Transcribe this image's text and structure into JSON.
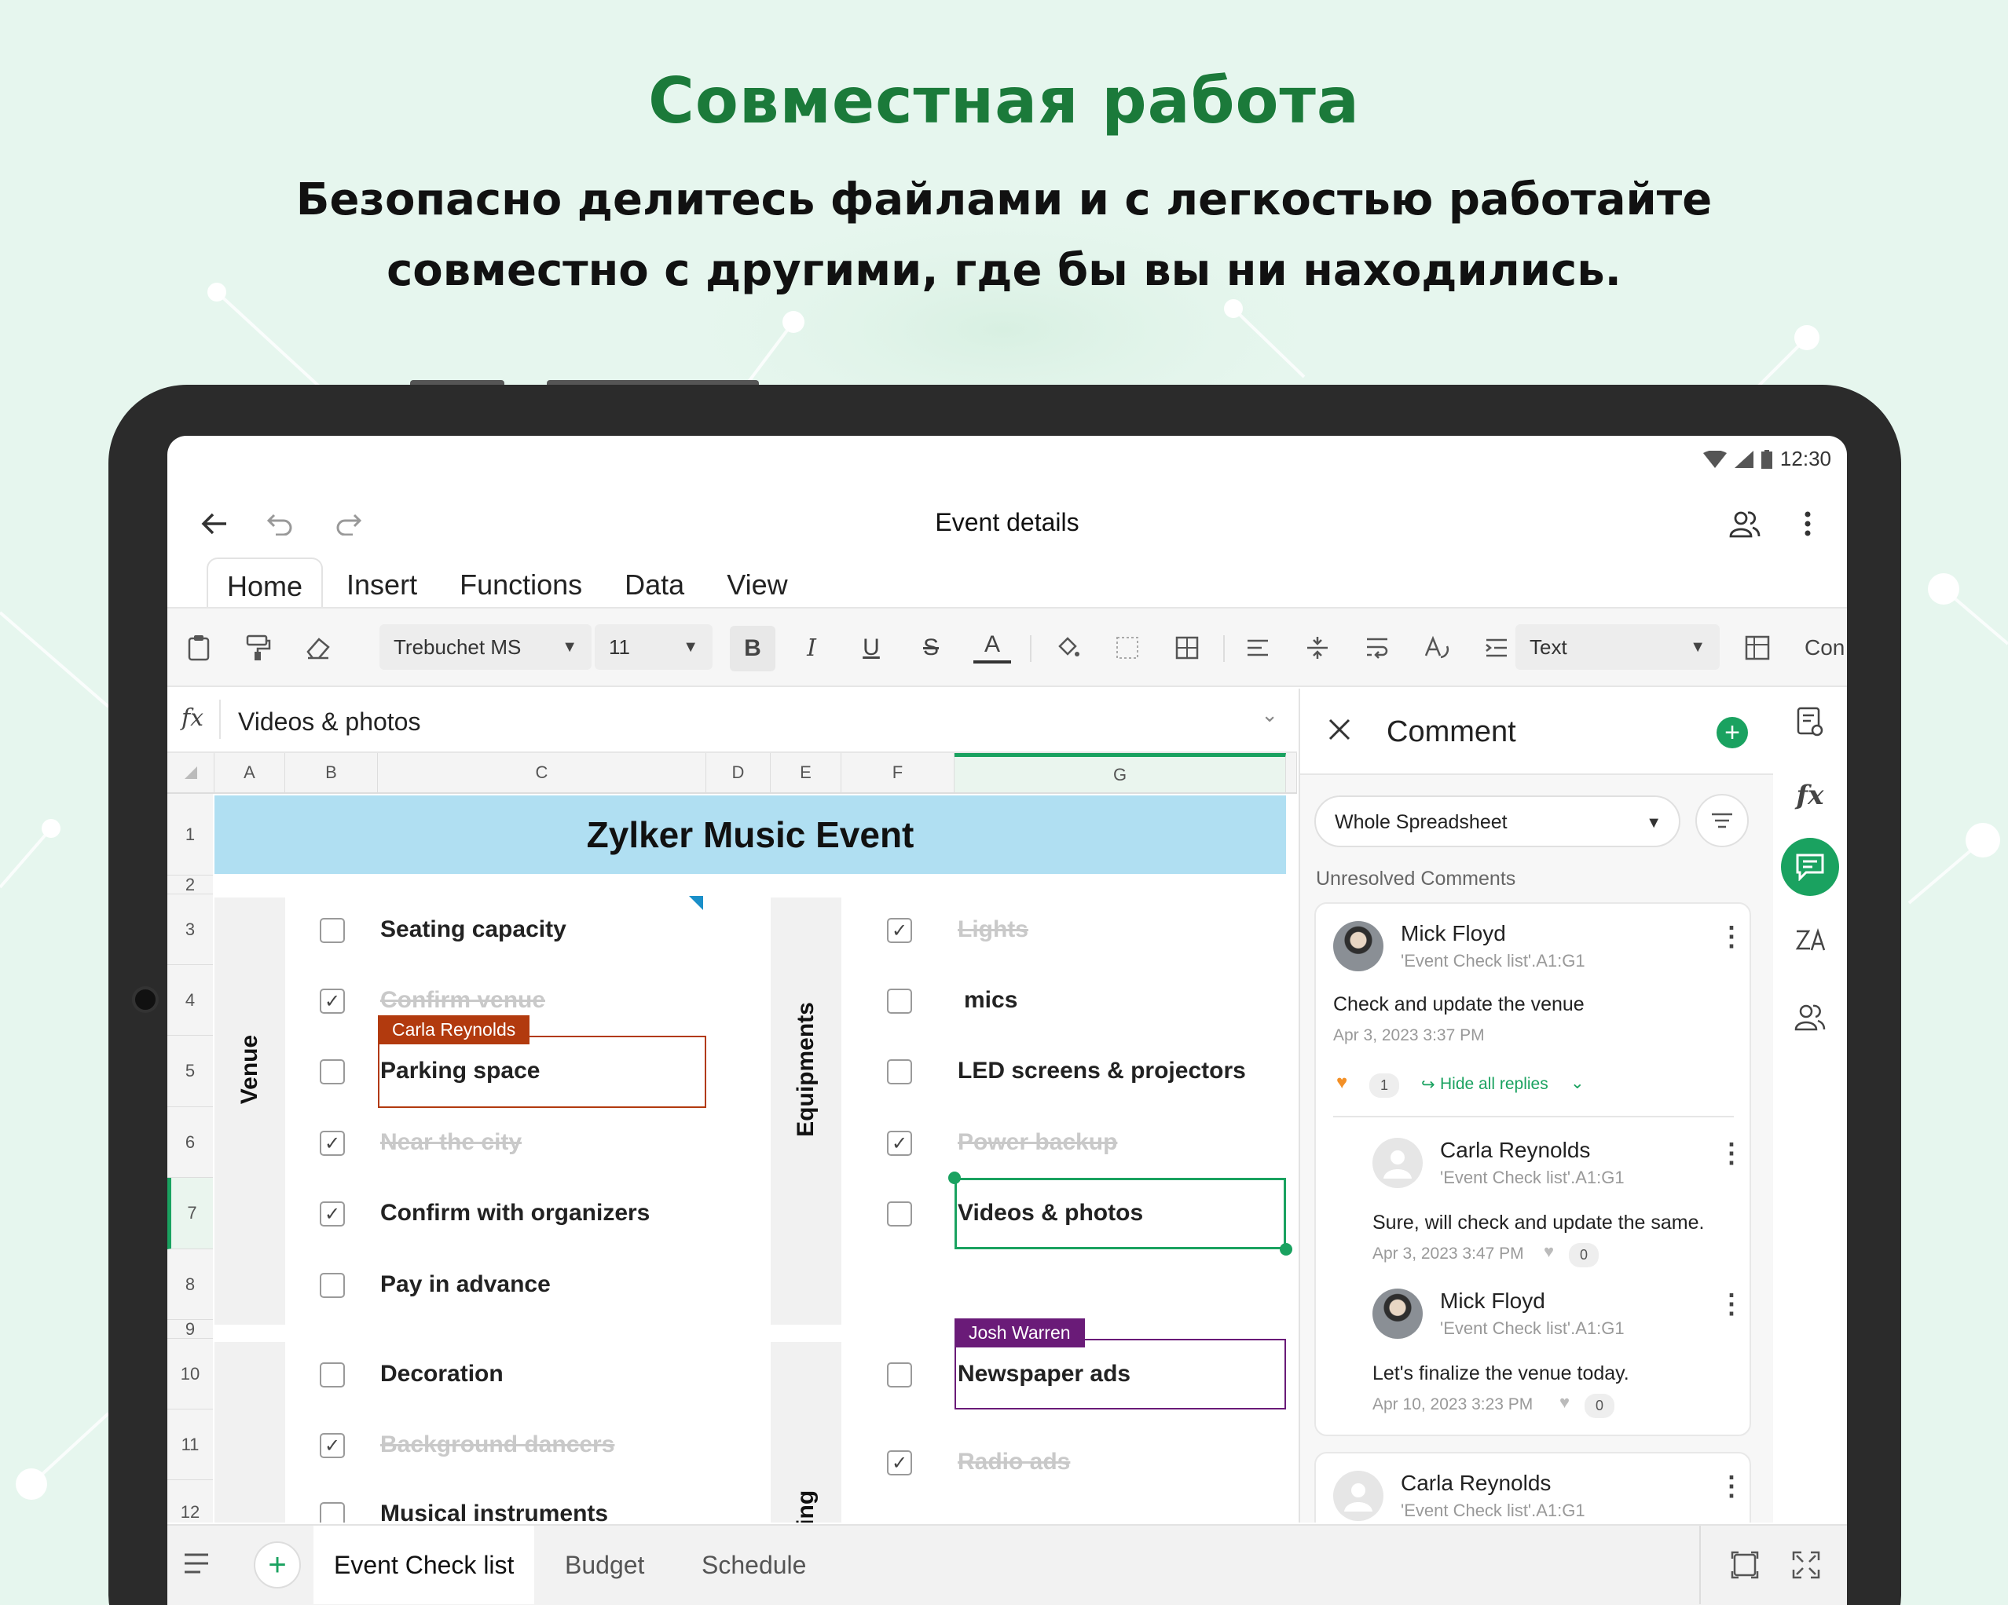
{
  "promo": {
    "title": "Совместная работа",
    "subtitle_line1": "Безопасно делитесь файлами и с легкостью работайте",
    "subtitle_line2": "совместно с другими, где бы вы ни находились."
  },
  "status": {
    "time": "12:30"
  },
  "app": {
    "title": "Event details",
    "tabs": [
      "Home",
      "Insert",
      "Functions",
      "Data",
      "View"
    ],
    "active_tab": "Home"
  },
  "toolbar": {
    "font": "Trebuchet MS",
    "size": "11",
    "format": "Text",
    "cond_label": "Con"
  },
  "formula_bar": {
    "fx": "fx",
    "value": "Videos & photos"
  },
  "sheet": {
    "columns": [
      "A",
      "B",
      "C",
      "D",
      "E",
      "F",
      "G"
    ],
    "rows": [
      "1",
      "2",
      "3",
      "4",
      "5",
      "6",
      "7",
      "8",
      "9",
      "10",
      "11",
      "12"
    ],
    "title": "Zylker Music Event",
    "group_venue": "Venue",
    "group_equipments": "Equipments",
    "group_marketing": "keting",
    "left_items": [
      {
        "text": "Seating capacity",
        "checked": false
      },
      {
        "text": "Confirm venue",
        "checked": true
      },
      {
        "text": "Parking space",
        "checked": false
      },
      {
        "text": "Near the city",
        "checked": true
      },
      {
        "text": "Confirm with organizers",
        "checked": true
      },
      {
        "text": "Pay in advance",
        "checked": false
      },
      {
        "text": "Decoration",
        "checked": false
      },
      {
        "text": "Background dancers",
        "checked": true
      },
      {
        "text": "Musical instruments",
        "checked": false
      }
    ],
    "right_items": [
      {
        "text": "Lights",
        "checked": true
      },
      {
        "text": "mics",
        "checked": false
      },
      {
        "text": "LED screens & projectors",
        "checked": false
      },
      {
        "text": "Power backup",
        "checked": true
      },
      {
        "text": "Videos & photos",
        "checked": false
      },
      {
        "text": "Newspaper ads",
        "checked": false
      },
      {
        "text": "Radio ads",
        "checked": true
      }
    ],
    "collab_carla": "Carla Reynolds",
    "collab_josh": "Josh Warren"
  },
  "comments": {
    "title": "Comment",
    "filter": "Whole Spreadsheet",
    "section": "Unresolved Comments",
    "thread": {
      "author": "Mick Floyd",
      "ref": "'Event Check list'.A1:G1",
      "text": "Check and update the venue",
      "date": "Apr 3, 2023 3:37 PM",
      "likes": "1",
      "hide_replies": "Hide all replies",
      "replies": [
        {
          "author": "Carla Reynolds",
          "ref": "'Event Check list'.A1:G1",
          "text": "Sure, will check and update the same.",
          "date": "Apr 3, 2023 3:47 PM",
          "likes": "0"
        },
        {
          "author": "Mick Floyd",
          "ref": "'Event Check list'.A1:G1",
          "text": "Let's finalize the venue today.",
          "date": "Apr 10, 2023 3:23 PM",
          "likes": "0"
        }
      ]
    },
    "second": {
      "author": "Carla Reynolds",
      "ref": "'Event Check list'.A1:G1"
    }
  },
  "sheet_tabs": [
    "Event Check list",
    "Budget",
    "Schedule"
  ],
  "colors": {
    "brand_green": "#1aa260",
    "title_green": "#1b7a3a",
    "carla_color": "#b23a0e",
    "josh_color": "#6a1b78",
    "banner_blue": "#b0dff2"
  }
}
